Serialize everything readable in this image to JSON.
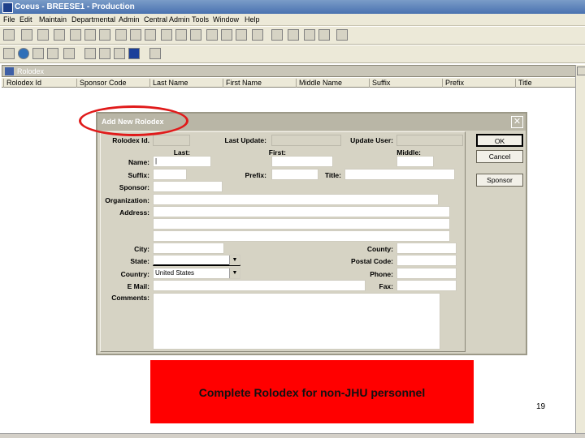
{
  "app": {
    "title": "Coeus - BREESE1 - Production"
  },
  "menu": [
    "File",
    "Edit",
    "Maintain",
    "Departmental",
    "Admin",
    "Central Admin",
    "Tools",
    "Window",
    "Help"
  ],
  "rolodex_window": {
    "title": "Rolodex",
    "columns": [
      "Rolodex Id",
      "Sponsor Code",
      "Last Name",
      "First Name",
      "Middle Name",
      "Suffix",
      "Prefix",
      "Title"
    ]
  },
  "dialog": {
    "title": "Add New Rolodex",
    "labels": {
      "rolodex_id": "Rolodex Id.",
      "last_update": "Last Update:",
      "update_user": "Update User:",
      "last": "Last:",
      "first": "First:",
      "middle": "Middle:",
      "name": "Name:",
      "suffix": "Suffix:",
      "prefix": "Prefix:",
      "title": "Title:",
      "sponsor": "Sponsor:",
      "organization": "Organization:",
      "address": "Address:",
      "city": "City:",
      "county": "County:",
      "state": "State:",
      "postal_code": "Postal Code:",
      "country": "Country:",
      "phone": "Phone:",
      "email": "E Mail:",
      "fax": "Fax:",
      "comments": "Comments:"
    },
    "values": {
      "country": "United States",
      "state": "",
      "name_last": "|"
    },
    "buttons": {
      "ok": "OK",
      "cancel": "Cancel",
      "sponsor": "Sponsor"
    },
    "close_glyph": "✕"
  },
  "annotation": {
    "callout_text": "Complete Rolodex for non-JHU personnel",
    "highlight_color": "#e01a1a",
    "callout_color": "#ff0000"
  },
  "page_number": "19"
}
